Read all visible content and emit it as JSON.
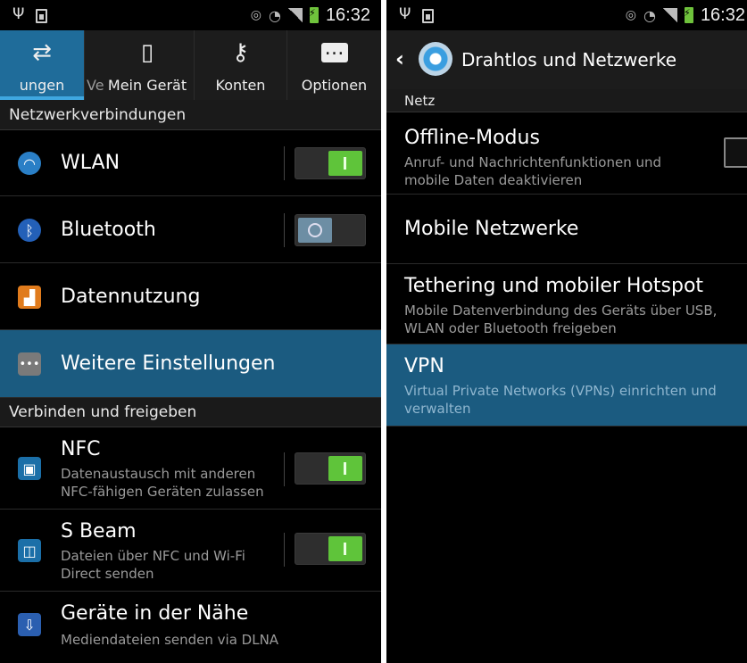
{
  "statusbar": {
    "time": "16:32"
  },
  "left": {
    "tabs": [
      {
        "label": "ungen",
        "icon": "settings-connections-icon",
        "active": true
      },
      {
        "label": "Ve",
        "icon": "",
        "active": false
      },
      {
        "label": "Mein Gerät",
        "icon": "device-icon",
        "active": false
      },
      {
        "label": "Konten",
        "icon": "key-icon",
        "active": false
      },
      {
        "label": "Optionen",
        "icon": "more-options-icon",
        "active": false
      }
    ],
    "sections": [
      {
        "title": "Netzwerkverbindungen"
      },
      {
        "title": "Verbinden und freigeben"
      }
    ],
    "rows": [
      {
        "title": "WLAN",
        "toggle": "on",
        "icon": "wifi-icon"
      },
      {
        "title": "Bluetooth",
        "toggle": "off",
        "icon": "bluetooth-icon"
      },
      {
        "title": "Datennutzung",
        "icon": "data-usage-icon"
      },
      {
        "title": "Weitere Einstellungen",
        "icon": "more-settings-icon",
        "highlighted": true
      },
      {
        "title": "NFC",
        "subtitle": "Datenaustausch mit anderen NFC-fähigen Geräten zulassen",
        "toggle": "on",
        "icon": "nfc-icon"
      },
      {
        "title": "S Beam",
        "subtitle": "Dateien über NFC und Wi-Fi Direct senden",
        "toggle": "on",
        "icon": "s-beam-icon"
      },
      {
        "title": "Geräte in der Nähe",
        "subtitle": "Mediendateien senden via DLNA",
        "icon": "nearby-devices-icon"
      }
    ]
  },
  "right": {
    "header_title": "Drahtlos und Netzwerke",
    "section": "Netz",
    "rows": [
      {
        "title": "Offline-Modus",
        "subtitle": "Anruf- und Nachrichtenfunktionen und mobile Daten deaktivieren",
        "checkbox": false
      },
      {
        "title": "Mobile Netzwerke"
      },
      {
        "title": "Tethering und mobiler Hotspot",
        "subtitle": "Mobile Datenverbindung des Geräts über USB, WLAN oder Bluetooth freigeben"
      },
      {
        "title": "VPN",
        "subtitle": "Virtual Private Networks (VPNs) einrichten und verwalten",
        "highlighted": true
      }
    ]
  },
  "colors": {
    "accent": "#1b5b80",
    "tab_active": "#1f6c9a",
    "toggle_on": "#5fc43a",
    "toggle_off": "#6d8ea4"
  }
}
